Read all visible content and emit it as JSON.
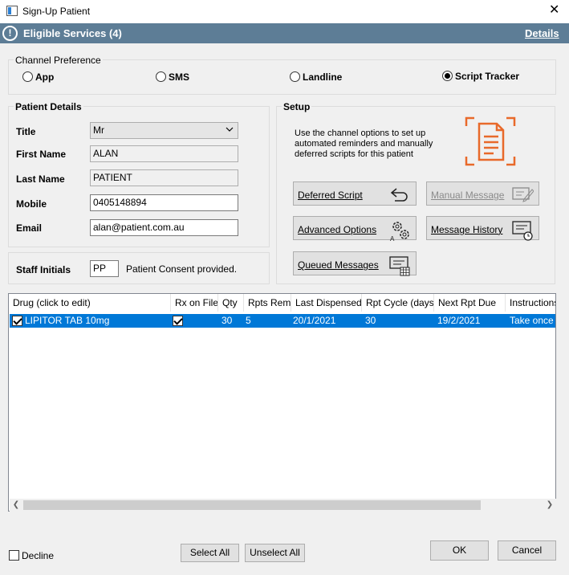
{
  "window": {
    "title": "Sign-Up Patient",
    "close": "✕"
  },
  "banner": {
    "icon_text": "!",
    "title": "Eligible Services (4)",
    "link": "Details"
  },
  "channel": {
    "label": "Channel Preference",
    "options": [
      {
        "label": "App",
        "checked": false
      },
      {
        "label": "SMS",
        "checked": false
      },
      {
        "label": "Landline",
        "checked": false
      },
      {
        "label": "Script Tracker",
        "checked": true
      }
    ]
  },
  "patient": {
    "label": "Patient Details",
    "title_label": "Title",
    "title_value": "Mr",
    "first_name_label": "First Name",
    "first_name": "ALAN",
    "last_name_label": "Last Name",
    "last_name": "PATIENT",
    "mobile_label": "Mobile",
    "mobile": "0405148894",
    "email_label": "Email",
    "email": "alan@patient.com.au"
  },
  "staff": {
    "label": "Staff Initials",
    "value": "PP",
    "consent": "Patient Consent provided."
  },
  "setup": {
    "label": "Setup",
    "description": "Use the channel options to set up automated reminders and manually deferred scripts for this patient",
    "buttons": {
      "deferred": "Deferred Script",
      "manual": "Manual Message",
      "advanced": "Advanced Options",
      "history": "Message History",
      "queued": "Queued Messages"
    },
    "accent": "#e8692a"
  },
  "grid": {
    "columns": [
      "Drug (click to edit)",
      "Rx on File",
      "Qty",
      "Rpts Rem",
      "Last Dispensed",
      "Rpt Cycle (days)",
      "Next Rpt Due",
      "Instructions"
    ],
    "rows": [
      {
        "selected": true,
        "drug": "LIPITOR TAB 10mg",
        "rx_on_file": true,
        "qty": "30",
        "rpts_rem": "5",
        "last_dispensed": "20/1/2021",
        "rpt_cycle": "30",
        "next_rpt_due": "19/2/2021",
        "instructions": "Take once d"
      }
    ],
    "selection_color": "#0078d7"
  },
  "footer": {
    "decline": "Decline",
    "select_all": "Select All",
    "unselect_all": "Unselect All",
    "ok": "OK",
    "cancel": "Cancel"
  }
}
